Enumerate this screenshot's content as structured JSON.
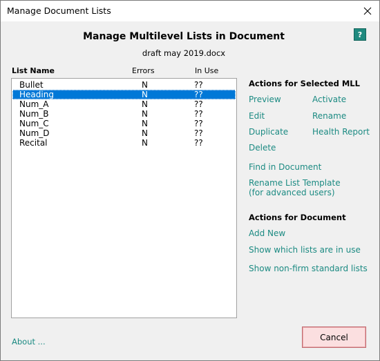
{
  "window": {
    "title": "Manage Document Lists"
  },
  "header": {
    "title": "Manage Multilevel Lists in Document",
    "filename": "draft may 2019.docx",
    "help_label": "?"
  },
  "table": {
    "columns": {
      "name": "List Name",
      "errors": "Errors",
      "in_use": "In Use"
    },
    "rows": [
      {
        "name": "Bullet",
        "errors": "N",
        "in_use": "??"
      },
      {
        "name": "Heading",
        "errors": "N",
        "in_use": "??"
      },
      {
        "name": "Num_A",
        "errors": "N",
        "in_use": "??"
      },
      {
        "name": "Num_B",
        "errors": "N",
        "in_use": "??"
      },
      {
        "name": "Num_C",
        "errors": "N",
        "in_use": "??"
      },
      {
        "name": "Num_D",
        "errors": "N",
        "in_use": "??"
      },
      {
        "name": "Recital",
        "errors": "N",
        "in_use": "??"
      }
    ],
    "selected_row": "Heading"
  },
  "actions_mll": {
    "title": "Actions for Selected MLL",
    "preview": "Preview",
    "activate": "Activate",
    "edit": "Edit",
    "rename": "Rename",
    "duplicate": "Duplicate",
    "health_report": "Health Report",
    "delete": "Delete",
    "find_in_document": "Find in Document",
    "rename_template_line1": "Rename List Template",
    "rename_template_line2": "(for advanced users)"
  },
  "actions_doc": {
    "title": "Actions for Document",
    "add_new": "Add New",
    "show_in_use": "Show which lists are in use",
    "show_non_firm": "Show non-firm standard lists"
  },
  "footer": {
    "about": "About ...",
    "cancel": "Cancel"
  },
  "colors": {
    "link": "#1b8a82",
    "selection": "#0078d7",
    "help_bg": "#1f8a7f",
    "cancel_bg": "#fbdfe0"
  }
}
